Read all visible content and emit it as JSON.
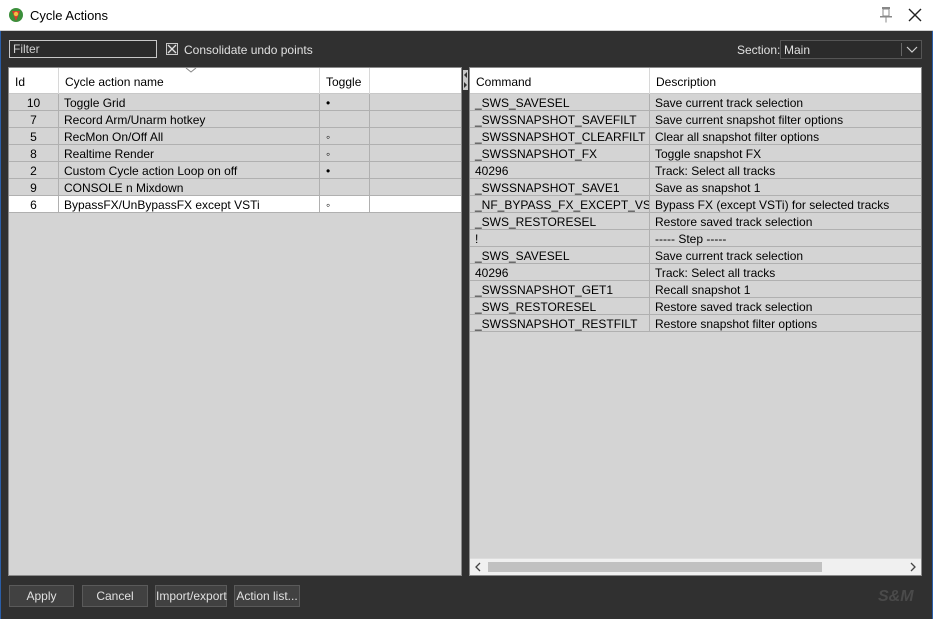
{
  "window": {
    "title": "Cycle Actions"
  },
  "toolbar": {
    "filter_placeholder": "Filter",
    "consolidate_label": "Consolidate undo points",
    "consolidate_checked": true,
    "section_label": "Section:",
    "section_value": "Main"
  },
  "left_table": {
    "headers": {
      "id": "Id",
      "name": "Cycle action name",
      "toggle": "Toggle"
    },
    "rows": [
      {
        "id": "10",
        "name": "Toggle Grid",
        "toggle": "•"
      },
      {
        "id": "7",
        "name": "Record Arm/Unarm hotkey",
        "toggle": ""
      },
      {
        "id": "5",
        "name": "RecMon On/Off All",
        "toggle": "◦"
      },
      {
        "id": "8",
        "name": "Realtime Render",
        "toggle": "◦"
      },
      {
        "id": "2",
        "name": "Custom Cycle action Loop on off",
        "toggle": "•"
      },
      {
        "id": "9",
        "name": "CONSOLE n Mixdown",
        "toggle": ""
      },
      {
        "id": "6",
        "name": "BypassFX/UnBypassFX except VSTi",
        "toggle": "◦"
      }
    ],
    "selected_row": 6
  },
  "right_table": {
    "headers": {
      "command": "Command",
      "description": "Description"
    },
    "rows": [
      {
        "command": "_SWS_SAVESEL",
        "description": "Save current track selection"
      },
      {
        "command": "_SWSSNAPSHOT_SAVEFILT",
        "description": "Save current snapshot filter options"
      },
      {
        "command": "_SWSSNAPSHOT_CLEARFILT",
        "description": "Clear all snapshot filter options"
      },
      {
        "command": "_SWSSNAPSHOT_FX",
        "description": "Toggle snapshot FX"
      },
      {
        "command": "40296",
        "description": "Track: Select all tracks"
      },
      {
        "command": "_SWSSNAPSHOT_SAVE1",
        "description": "Save as snapshot 1"
      },
      {
        "command": "_NF_BYPASS_FX_EXCEPT_VSTI_...",
        "description": "Bypass FX (except VSTi) for selected tracks"
      },
      {
        "command": "_SWS_RESTORESEL",
        "description": "Restore saved track selection"
      },
      {
        "command": "!",
        "description": "----- Step -----"
      },
      {
        "command": "_SWS_SAVESEL",
        "description": "Save current track selection"
      },
      {
        "command": "40296",
        "description": "Track: Select all tracks"
      },
      {
        "command": "_SWSSNAPSHOT_GET1",
        "description": "Recall snapshot 1"
      },
      {
        "command": "_SWS_RESTORESEL",
        "description": "Restore saved track selection"
      },
      {
        "command": "_SWSSNAPSHOT_RESTFILT",
        "description": "Restore snapshot filter options"
      }
    ]
  },
  "buttons": {
    "apply": "Apply",
    "cancel": "Cancel",
    "import_export": "Import/export",
    "action_list": "Action list..."
  },
  "watermark": "S&M",
  "colors": {
    "frame": "#303030",
    "panel": "#d4d4d4",
    "header": "#ffffff",
    "selected_row": "#ffffff",
    "accent_border": "#2a5ea8"
  }
}
